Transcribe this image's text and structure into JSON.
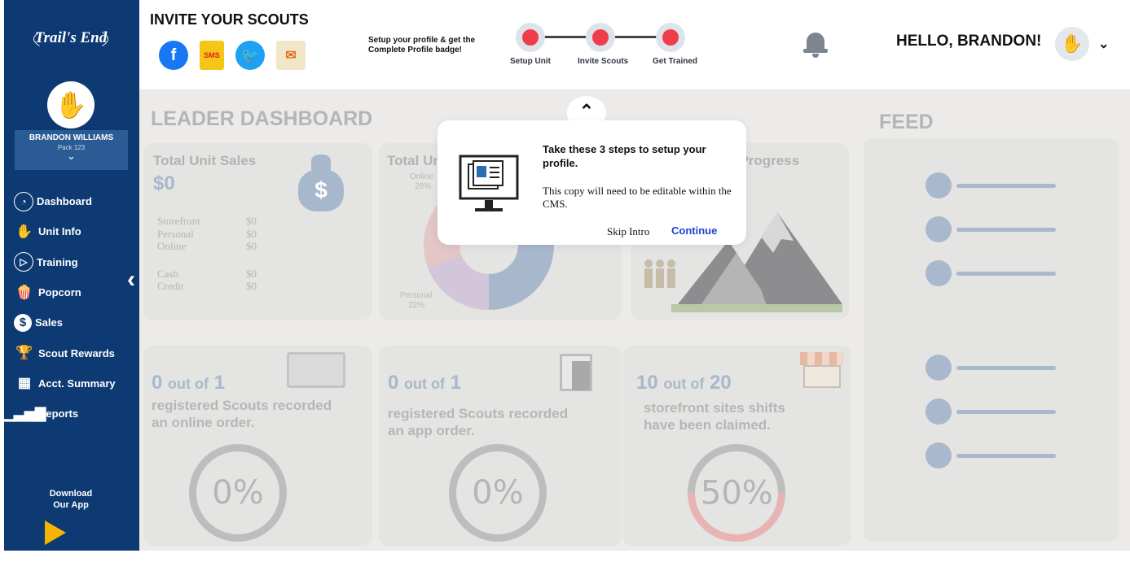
{
  "sidebar": {
    "logo": "Trail's End",
    "user": {
      "name": "BRANDON WILLIAMS",
      "pack": "Pack 123"
    },
    "items": [
      {
        "label": "Dashboard",
        "icon": "dashboard-gauge-icon"
      },
      {
        "label": "Unit Info",
        "icon": "scout-sign-hand-icon"
      },
      {
        "label": "Training",
        "icon": "play-circle-icon"
      },
      {
        "label": "Popcorn",
        "icon": "popcorn-icon"
      },
      {
        "label": "Sales",
        "icon": "dollar-circle-icon"
      },
      {
        "label": "Scout Rewards",
        "icon": "trophy-icon"
      },
      {
        "label": "Acct. Summary",
        "icon": "calculator-icon"
      },
      {
        "label": "Reports",
        "icon": "bar-chart-icon"
      }
    ],
    "download": {
      "line1": "Download",
      "line2": "Our App"
    }
  },
  "header": {
    "invite_title": "INVITE YOUR SCOUTS",
    "social_icons": [
      "facebook-icon",
      "sms-icon",
      "twitter-icon",
      "email-icon"
    ],
    "sms_label": "SMS",
    "setup_text_line1": "Setup your profile & get the",
    "setup_text_line2": "Complete Profile badge!",
    "steps": [
      "Setup Unit",
      "Invite Scouts",
      "Get Trained"
    ],
    "greeting": "HELLO, BRANDON!",
    "accent_color": "#ef3e4a"
  },
  "dashboard": {
    "title": "LEADER DASHBOARD",
    "feed_title": "FEED",
    "total_sales": {
      "title": "Total Unit Sales",
      "value": "$0",
      "rows": [
        {
          "label": "Storefront",
          "value": "$0"
        },
        {
          "label": "Personal",
          "value": "$0"
        },
        {
          "label": "Online",
          "value": "$0"
        }
      ],
      "rows2": [
        {
          "label": "Cash",
          "value": "$0"
        },
        {
          "label": "Credit",
          "value": "$0"
        }
      ]
    },
    "total_unit": {
      "title": "Total Ur",
      "online_label": "Online",
      "online_pct": "28%",
      "personal_label": "Personal",
      "personal_pct": "22%"
    },
    "progress": {
      "title": "l Progress"
    },
    "stats": [
      {
        "num": "0",
        "of": "out of",
        "total": "1",
        "text1": "registered Scouts recorded",
        "text2": "an online order.",
        "pct": "0%"
      },
      {
        "num": "0",
        "of": "out of",
        "total": "1",
        "text1": "registered Scouts recorded",
        "text2": "an app order.",
        "pct": "0%"
      },
      {
        "num": "10",
        "of": "out of",
        "total": "20",
        "text1": "storefront sites shifts",
        "text2": "have been claimed.",
        "pct": "50%"
      }
    ]
  },
  "popup": {
    "title": "Take these 3 steps to setup your profile.",
    "body": "This copy will need to be editable within the CMS.",
    "skip": "Skip Intro",
    "continue": "Continue"
  }
}
